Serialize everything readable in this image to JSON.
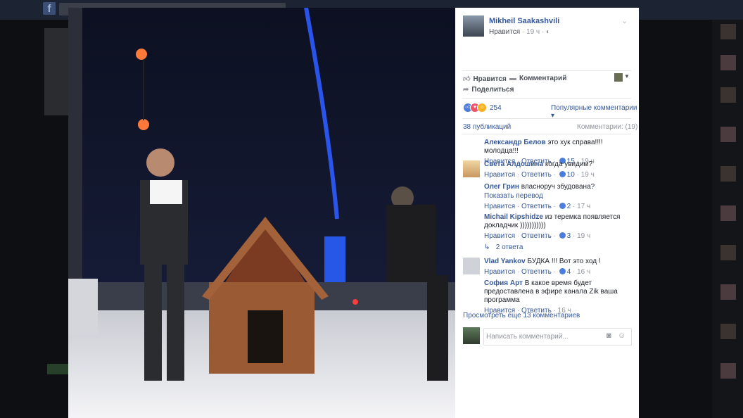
{
  "background": {
    "logo": "f"
  },
  "post": {
    "author": "Mikheil Saakashvili",
    "like_label": "Нравится",
    "time": "19 ч",
    "globe_icon": "globe-icon"
  },
  "actions": {
    "like": "Нравится",
    "comment": "Комментарий",
    "share": "Поделиться"
  },
  "reactions": {
    "count": "254",
    "icons": [
      "like-icon",
      "love-icon",
      "haha-icon"
    ],
    "colors": {
      "like": "#4a7dde",
      "love": "#f25268",
      "haha": "#f7b125"
    }
  },
  "sort_label": "Популярные комментарии",
  "publications": "38 публикаций",
  "comments_count": "Комментарии: (19)",
  "comments": [
    {
      "name": "Александр Белов",
      "text": "это хук справа!!!! молодца!!!",
      "reply": "Ответить",
      "like": "Нравится",
      "likes": "15",
      "time": "19 ч"
    },
    {
      "name": "Света Алдошина",
      "text": "когда увидим?",
      "reply": "Ответить",
      "like": "Нравится",
      "likes": "10",
      "time": "19 ч"
    },
    {
      "name": "Олег Грин",
      "text": "власноруч збудована?",
      "translate": "Показать перевод",
      "reply": "Ответить",
      "like": "Нравится",
      "likes": "2",
      "time": "17 ч"
    },
    {
      "name": "Michail Kipshidze",
      "text": "из теремка появляется докладчик )))))))))))",
      "reply": "Ответить",
      "like": "Нравится",
      "likes": "3",
      "time": "19 ч"
    },
    {
      "name": "Vlad Yankov",
      "text": "БУДКА !!! Вот это ход !",
      "reply": "Ответить",
      "like": "Нравится",
      "likes": "4",
      "time": "16 ч"
    },
    {
      "name": "София Арт",
      "text": "В какое время будет предоставлена в эфире канала Zik ваша программа",
      "reply": "Ответить",
      "like": "Нравится",
      "time": "16 ч"
    }
  ],
  "replies_link": "2 ответа",
  "more_comments": "Просмотреть еще 13 комментариев",
  "comment_input": {
    "placeholder": "Написать комментарий..."
  }
}
